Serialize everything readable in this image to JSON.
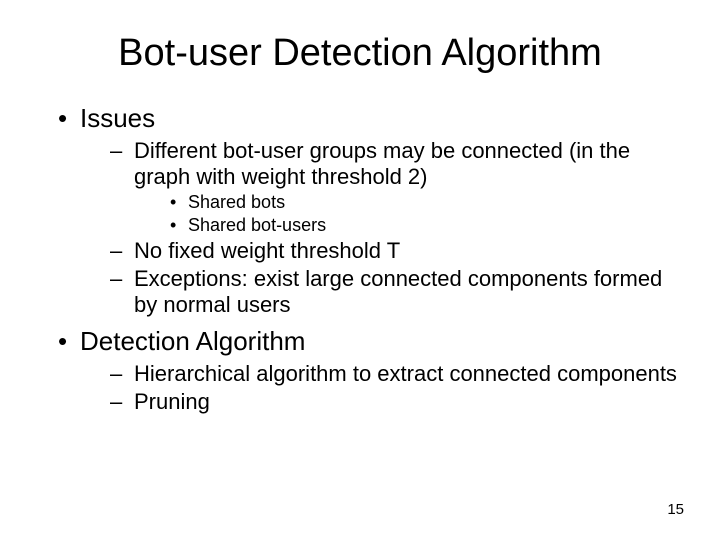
{
  "title": "Bot-user Detection Algorithm",
  "bullets": {
    "issues": {
      "label": "Issues",
      "sub": {
        "diff": "Different bot-user groups may be connected (in the graph with weight threshold 2)",
        "sharedBots": "Shared bots",
        "sharedBotUsers": "Shared bot-users",
        "noFixed": "No fixed weight threshold T",
        "exceptions": "Exceptions: exist large connected components formed by normal users"
      }
    },
    "detection": {
      "label": "Detection Algorithm",
      "sub": {
        "hier": "Hierarchical algorithm to extract connected components",
        "pruning": "Pruning"
      }
    }
  },
  "pageNumber": "15"
}
